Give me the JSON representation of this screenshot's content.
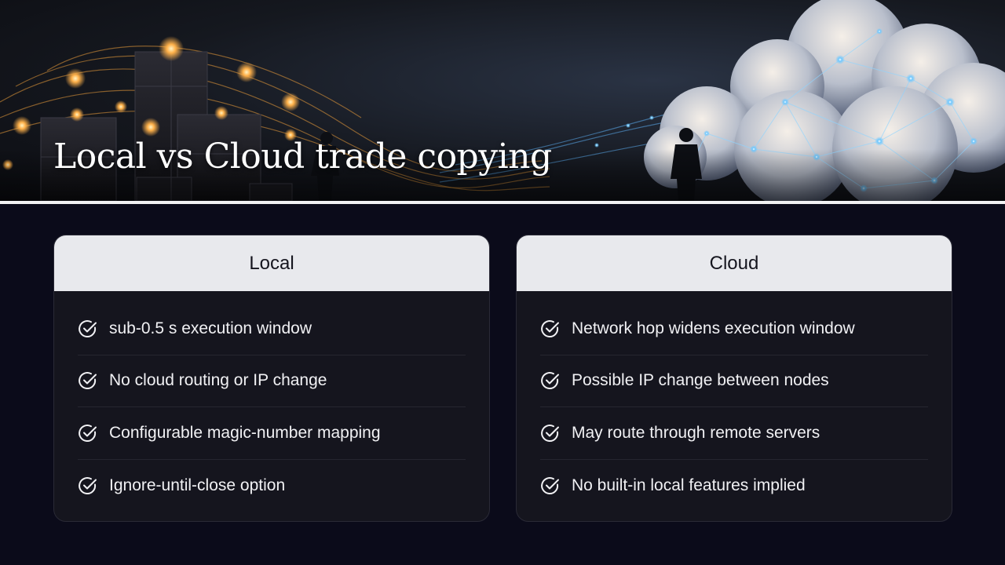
{
  "banner": {
    "title": "Local vs Cloud trade copying"
  },
  "columns": {
    "local": {
      "heading": "Local",
      "items": [
        "sub-0.5 s execution window",
        "No cloud routing or IP change",
        "Configurable magic-number mapping",
        "Ignore-until-close option"
      ]
    },
    "cloud": {
      "heading": "Cloud",
      "items": [
        "Network hop widens execution window",
        "Possible IP change between nodes",
        "May route through remote servers",
        "No built-in local features implied"
      ]
    }
  },
  "icons": {
    "item_marker": "check-circle-icon"
  },
  "colors": {
    "background": "#0b0b1a",
    "card_background": "#15151e",
    "card_header": "#e8e9ed",
    "text_light": "#f1f1f4",
    "text_dark": "#15151e",
    "glow_orange": "#ffb14a",
    "glow_blue": "#6fc8ff"
  }
}
